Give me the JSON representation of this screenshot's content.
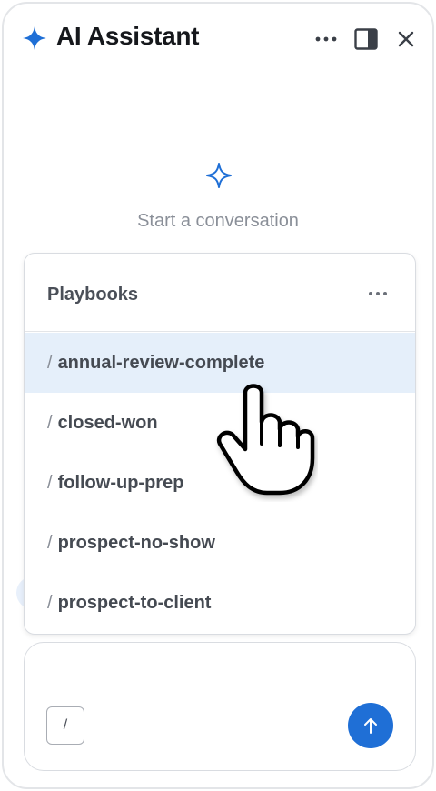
{
  "header": {
    "title": "AI Assistant",
    "brand_icon": "sparkle-icon",
    "brand_color": "#1f6fd6",
    "actions": [
      "more-horizontal-icon",
      "side-panel-icon",
      "close-icon"
    ]
  },
  "empty_state": {
    "icon": "sparkle-outline-icon",
    "text": "Start a conversation"
  },
  "playbooks": {
    "title": "Playbooks",
    "slash": "/",
    "items": [
      {
        "label": "annual-review-complete",
        "active": true
      },
      {
        "label": "closed-won",
        "active": false
      },
      {
        "label": "follow-up-prep",
        "active": false
      },
      {
        "label": "prospect-no-show",
        "active": false
      },
      {
        "label": "prospect-to-client",
        "active": false
      }
    ]
  },
  "composer": {
    "slash_label": "/",
    "send_icon": "arrow-up-icon",
    "send_color": "#1f6fd6"
  },
  "colors": {
    "highlight": "#e5effa",
    "border": "#d9dce1"
  }
}
